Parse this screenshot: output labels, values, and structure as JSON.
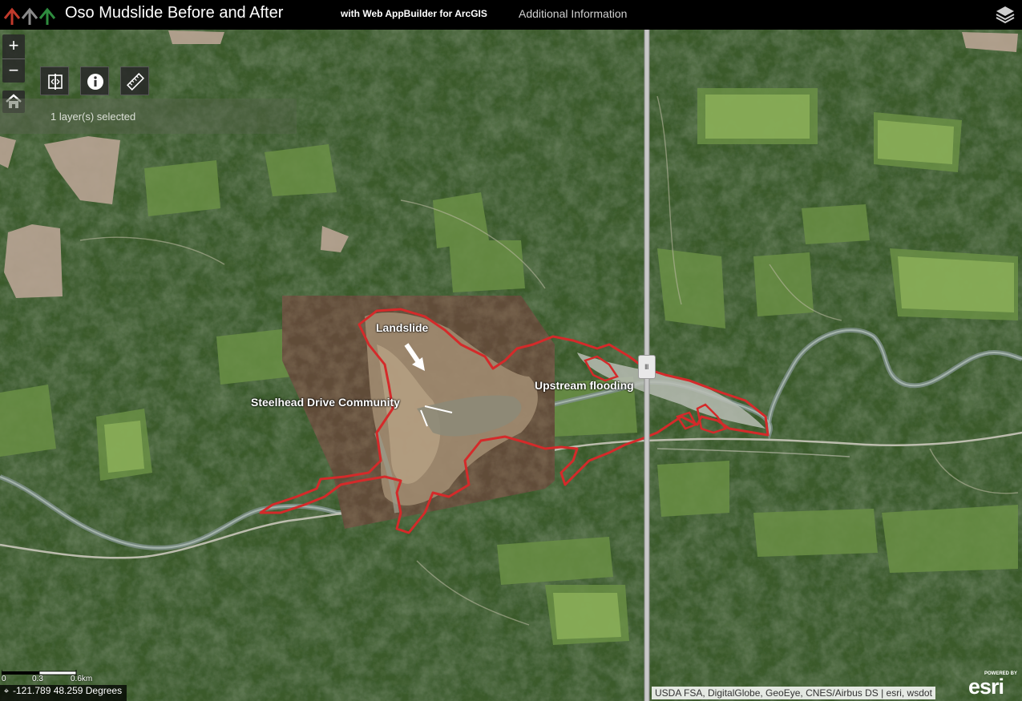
{
  "header": {
    "title": "Oso Mudslide Before and After",
    "subtitle": "with Web AppBuilder for ArcGIS",
    "link": "Additional Information"
  },
  "map": {
    "zoom_in": "+",
    "zoom_out": "−",
    "layer_status": "1 layer(s) selected",
    "labels": {
      "landslide": "Landslide",
      "steelhead": "Steelhead Drive Community",
      "upstream": "Upstream flooding"
    },
    "swipe_handle": "III",
    "scale": {
      "t0": "0",
      "t1": "0.3",
      "t2": "0.6km"
    },
    "coords": "-121.789 48.259 Degrees",
    "attribution": "USDA FSA, DigitalGlobe, GeoEye, CNES/Airbus DS | esri, wsdot",
    "esri_powered": "POWERED BY",
    "esri_word": "esri"
  },
  "colors": {
    "outline": "#d42a2a",
    "header_bg": "#000000",
    "forest": "#2f4a24"
  }
}
